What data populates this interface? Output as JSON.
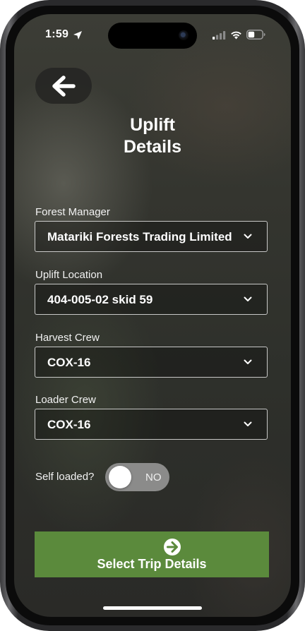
{
  "status_bar": {
    "time": "1:59",
    "icons": [
      "location-arrow-icon",
      "cellular-signal-icon",
      "wifi-icon",
      "battery-icon"
    ]
  },
  "header": {
    "back_icon": "arrow-left-icon",
    "title_line1": "Uplift",
    "title_line2": "Details"
  },
  "form": {
    "forest_manager": {
      "label": "Forest Manager",
      "value": "Matariki Forests Trading Limited"
    },
    "uplift_location": {
      "label": "Uplift Location",
      "value": "404-005-02 skid 59"
    },
    "harvest_crew": {
      "label": "Harvest Crew",
      "value": "COX-16"
    },
    "loader_crew": {
      "label": "Loader Crew",
      "value": "COX-16"
    },
    "self_loaded": {
      "label": "Self loaded?",
      "state_text": "NO",
      "checked": false
    }
  },
  "actions": {
    "primary_icon": "arrow-circle-right-icon",
    "primary_label": "Select Trip Details"
  },
  "colors": {
    "primary_button": "#5b8a3c",
    "toggle_off": "#8b8b8a",
    "text": "#ffffff"
  }
}
